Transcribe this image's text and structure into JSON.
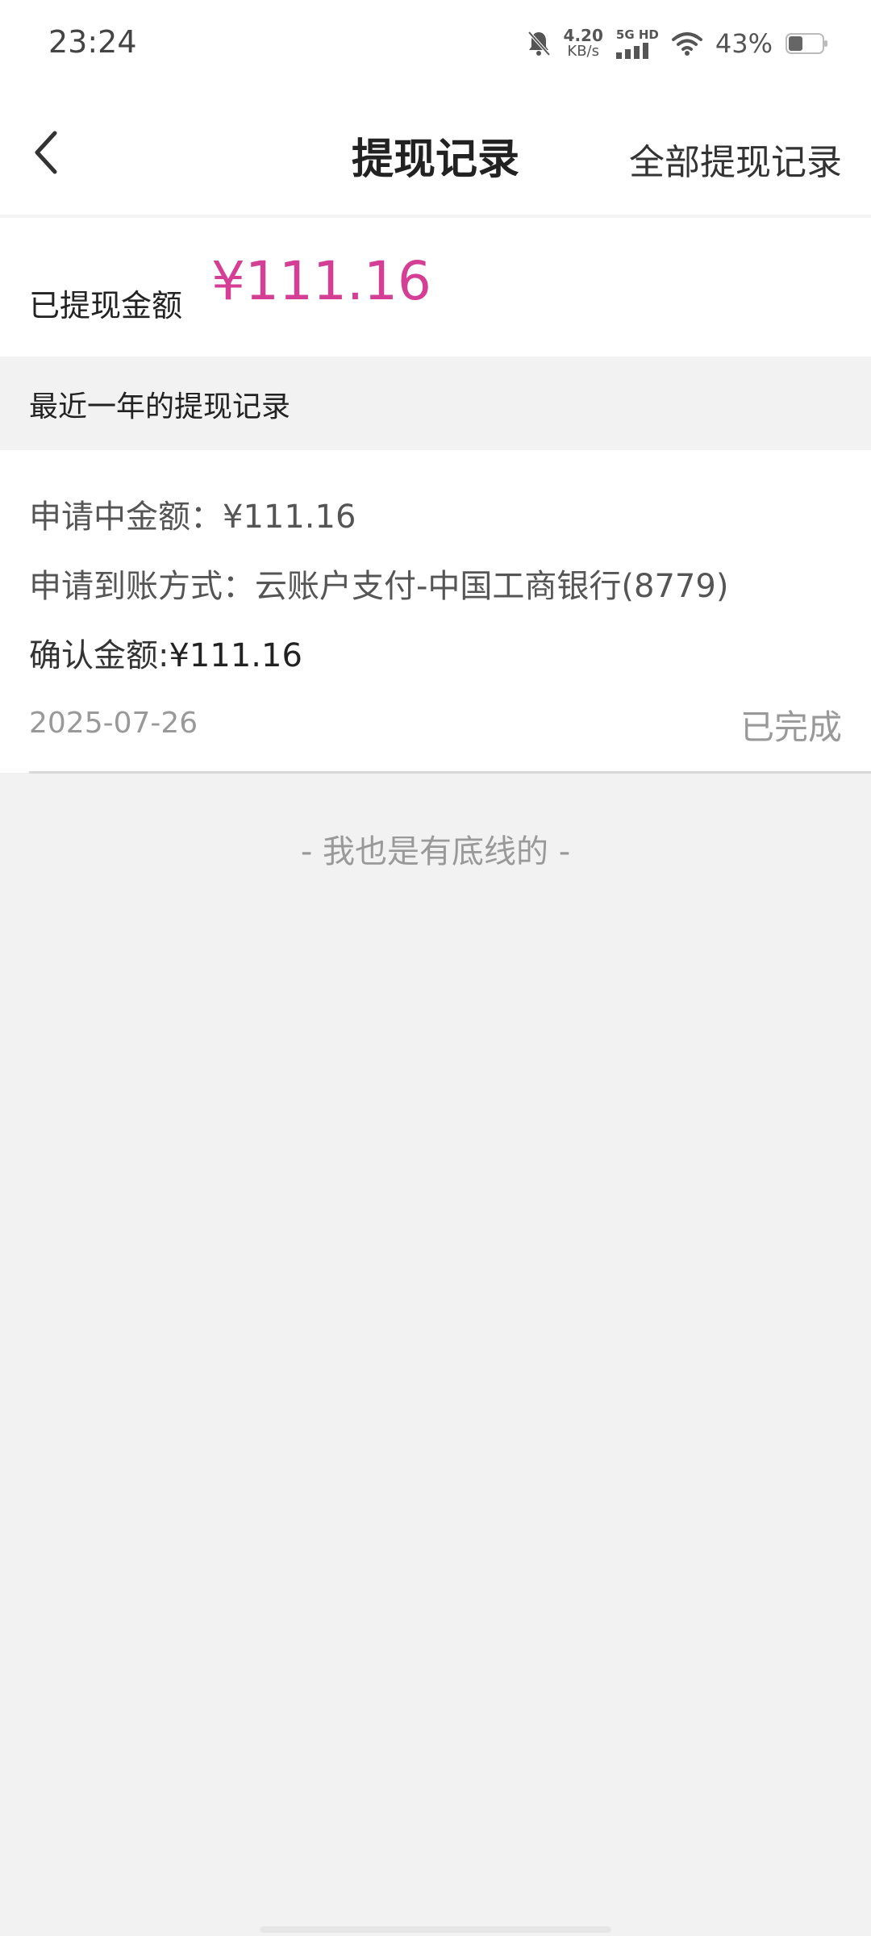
{
  "status_bar": {
    "time": "23:24",
    "net_speed_value": "4.20",
    "net_speed_unit": "KB/s",
    "network_label": "5G HD",
    "battery_percent": "43%",
    "battery_level": 0.43,
    "icons": [
      "bell-muted-icon",
      "signal-icon",
      "wifi-icon",
      "battery-icon"
    ]
  },
  "header": {
    "back_icon": "chevron-left-icon",
    "title": "提现记录",
    "all_records_link": "全部提现记录"
  },
  "summary": {
    "label": "已提现金额",
    "amount": "¥111.16"
  },
  "section": {
    "title": "最近一年的提现记录"
  },
  "record": {
    "applying_label": "申请中金额：",
    "applying_value": "¥111.16",
    "method_label": "申请到账方式：",
    "method_value": "云账户支付-中国工商银行(8779)",
    "confirm_label": "确认金额:",
    "confirm_value": "¥111.16",
    "date": "2025-07-26",
    "status": "已完成"
  },
  "footer": {
    "text": "- 我也是有底线的 -"
  },
  "colors": {
    "accent": "#d43f95",
    "background": "#f2f2f2",
    "card": "#ffffff",
    "muted_text": "#999999"
  }
}
